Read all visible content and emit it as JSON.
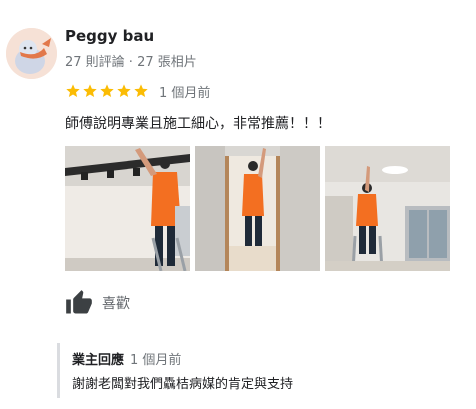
{
  "review": {
    "author_name": "Peggy bau",
    "author_meta": "27 則評論 · 27 張相片",
    "rating": 5,
    "time": "1 個月前",
    "text": "師傅說明專業且施工細心，非常推薦！！！",
    "photos": [
      "photo-1",
      "photo-2",
      "photo-3"
    ],
    "like_label": "喜歡"
  },
  "owner_reply": {
    "label": "業主回應",
    "time": "1 個月前",
    "text": "謝謝老闆對我們驫桔病媒的肯定與支持"
  },
  "colors": {
    "star": "#fbbc04",
    "uniform": "#f36f21",
    "reply_border": "#dadce0"
  }
}
